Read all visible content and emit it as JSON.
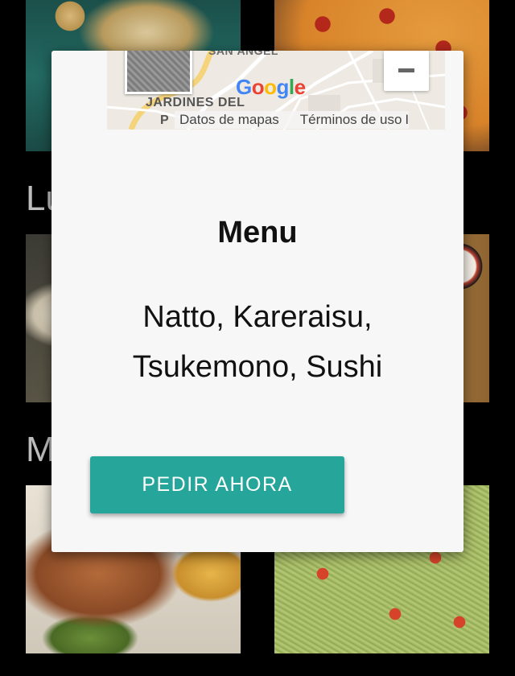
{
  "sections": {
    "lunch_partial": "Lu",
    "dinner_partial": "M"
  },
  "map": {
    "label_top": "SAN ÁNGEL",
    "label_area_line1": "JARDINES DEL",
    "label_area_line2": "P",
    "logo": [
      "G",
      "o",
      "o",
      "g",
      "l",
      "e"
    ],
    "logo_colors": [
      "#4285F4",
      "#EA4335",
      "#FBBC05",
      "#4285F4",
      "#34A853",
      "#EA4335"
    ],
    "attribution_data": "Datos de mapas",
    "attribution_terms": "Términos de uso",
    "attribution_more": "I"
  },
  "modal": {
    "title": "Menu",
    "items_line1": "Natto, Kareraisu,",
    "items_line2": "Tsukemono, Sushi",
    "order_button": "PEDIR AHORA"
  },
  "colors": {
    "accent": "#26a69a",
    "modal_bg": "#f7f7f7",
    "page_bg": "#000000"
  }
}
